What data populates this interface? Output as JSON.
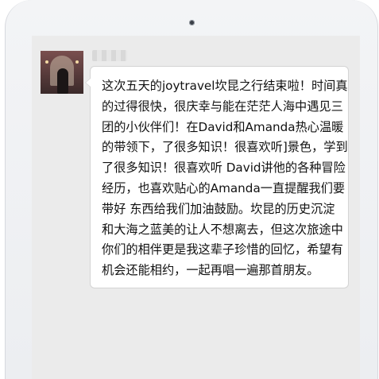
{
  "chat": {
    "sender_name": "",
    "message_lines": [
      "这次五天的joytravel坎昆之行结束啦！时间真",
      "的过得很快，很庆幸与能在茫茫人海中遇见三",
      "团的小伙伴们！在David和Amanda热心温暖",
      "的带领下，了很多知识！很喜欢听]景色，学到",
      "了很多知识！很喜欢听 David讲他的各种冒险",
      "经历，也喜欢贴心的Amanda一直提醒我们要",
      "带好 东西给我们加油鼓励。坎昆的历史沉淀",
      "和大海之蓝美的让人不想离去，但这次旅途中",
      "你们的相伴更是我这辈子珍惜的回忆，希望有",
      "机会还能相约，一起再唱一遍那首朋友。"
    ]
  }
}
